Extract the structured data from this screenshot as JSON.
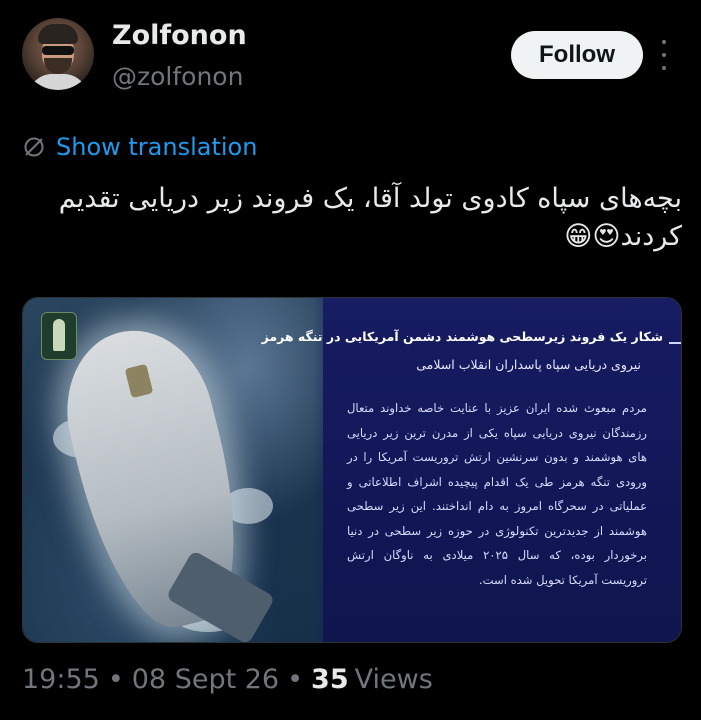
{
  "author": {
    "name": "Zolfonon",
    "handle": "@zolfonon",
    "follow_label": "Follow"
  },
  "translation": {
    "label": "Show translation",
    "icon": "globe-slash-icon"
  },
  "tweet": {
    "text": "بچه‌های سپاه کادوی تولد آقا، یک فروند زیر دریایی تقدیم کردند😍😁"
  },
  "media": {
    "title": "شکار یک فروند زیرسطحی هوشمند دشمن آمریکایی در تنگه هرمز",
    "subtitle": "نیروی دریایی سپاه پاسداران انقلاب اسلامی",
    "body": "مردم مبعوث شده ایران عزیز با عنایت خاصه خداوند متعال رزمندگان نیروی دریایی سپاه یکی از مدرن ترین زیر دریایی های هوشمند و بدون سرنشین ارتش تروریست آمریکا را در ورودی تنگه هرمز طی یک اقدام پیچیده اشراف اطلاعاتی و عملیاتی در سحرگاه امروز به دام انداختند. این زیر سطحی هوشمند از جدیدترین تکنولوژی در حوزه زیر سطحی در دنیا برخوردار بوده، که سال ۲۰۲۵ میلادی به ناوگان ارتش تروریست آمریکا تحویل شده است."
  },
  "meta": {
    "time": "19:55",
    "date": "08 Sept 26",
    "views_count": "35",
    "views_label": "Views",
    "separator": "•"
  },
  "colors": {
    "background": "#000000",
    "text": "#e7e9ea",
    "muted": "#71767b",
    "link": "#1d9bf0",
    "panel": "#151b5e"
  }
}
